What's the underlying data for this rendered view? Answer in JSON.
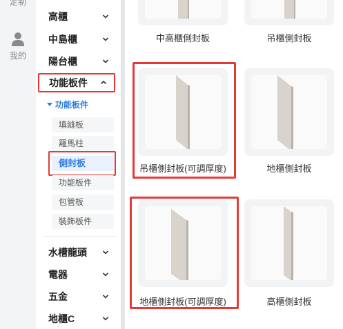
{
  "rail": {
    "top_label": "定制",
    "mine_label": "我的"
  },
  "categories": [
    {
      "label": "高櫃",
      "state": "collapsed"
    },
    {
      "label": "中島櫃",
      "state": "collapsed"
    },
    {
      "label": "陽台櫃",
      "state": "collapsed"
    },
    {
      "label": "功能板件",
      "state": "expanded"
    },
    {
      "label": "水槽龍頭",
      "state": "collapsed"
    },
    {
      "label": "電器",
      "state": "collapsed"
    },
    {
      "label": "五金",
      "state": "collapsed"
    },
    {
      "label": "地櫃C",
      "state": "collapsed"
    }
  ],
  "subcategory": {
    "label": "功能板件",
    "items": [
      "填縫板",
      "羅馬柱",
      "側封板",
      "功能板件",
      "包管板",
      "裝飾板件"
    ],
    "active": "側封板"
  },
  "products": [
    {
      "name": "中高櫃側封板"
    },
    {
      "name": "吊櫃側封板"
    },
    {
      "name": "吊櫃側封板(可調厚度)"
    },
    {
      "name": "地櫃側封板"
    },
    {
      "name": "地櫃側封板(可調厚度)"
    },
    {
      "name": "高櫃側封板"
    }
  ],
  "colors": {
    "accent": "#2f7de1",
    "highlight": "#e53935",
    "panel_fill": "#d9d3cd"
  }
}
